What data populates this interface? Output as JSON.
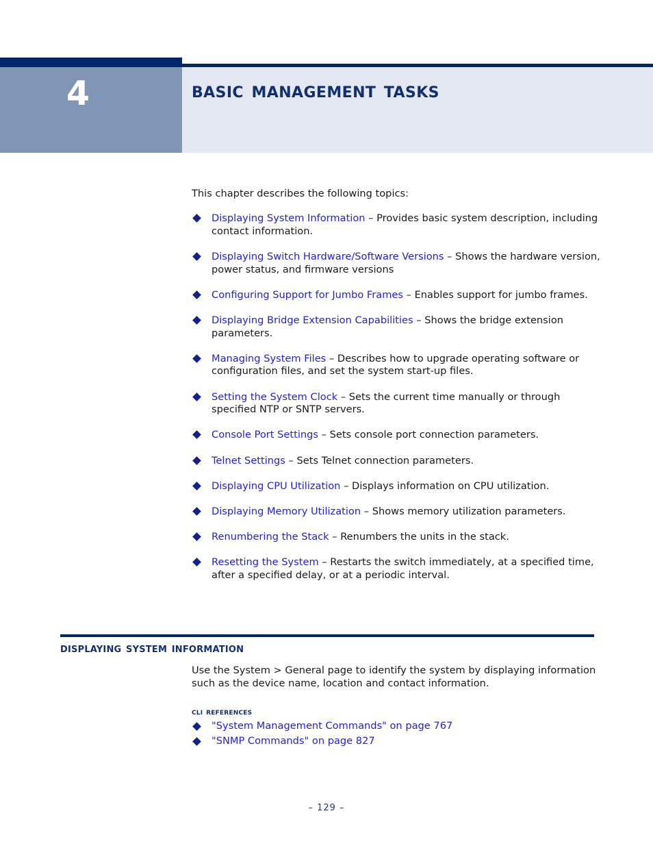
{
  "chapter": {
    "number": "4",
    "title": "Basic Management Tasks"
  },
  "intro": "This chapter describes the following topics:",
  "topics": [
    {
      "link": "Displaying System Information",
      "desc": " – Provides basic system description, including contact information."
    },
    {
      "link": "Displaying Switch Hardware/Software Versions",
      "desc": " – Shows the hardware version, power status, and firmware versions"
    },
    {
      "link": "Configuring Support for Jumbo Frames",
      "desc": " – Enables support for jumbo frames."
    },
    {
      "link": "Displaying Bridge Extension Capabilities",
      "desc": " – Shows the bridge extension parameters."
    },
    {
      "link": "Managing System Files",
      "desc": " – Describes how to upgrade operating software or configuration files, and set the system start-up files."
    },
    {
      "link": "Setting the System Clock",
      "desc": " – Sets the current time manually or through specified NTP or SNTP servers."
    },
    {
      "link": "Console Port Settings",
      "desc": " – Sets console port connection parameters."
    },
    {
      "link": "Telnet Settings",
      "desc": " – Sets Telnet connection parameters."
    },
    {
      "link": "Displaying CPU Utilization",
      "desc": " – Displays information on CPU utilization."
    },
    {
      "link": "Displaying Memory Utilization",
      "desc": " – Shows memory utilization parameters."
    },
    {
      "link": "Renumbering the Stack",
      "desc": " – Renumbers the units in the stack."
    },
    {
      "link": "Resetting the System",
      "desc": " – Restarts the switch immediately, at a specified time, after a specified delay, or at a periodic interval."
    }
  ],
  "section": {
    "heading": "Displaying System Information",
    "body": "Use the System > General page to identify the system by displaying information such as the device name, location and contact information.",
    "cli_title": "CLI References",
    "cli_items": [
      "\"System Management Commands\" on page 767",
      "\"SNMP Commands\" on page 827"
    ]
  },
  "footer": {
    "page_label": "–  129  –"
  },
  "colors": {
    "navy": "#002868",
    "heading_navy": "#12306e",
    "sidebar_blue": "#8195b4",
    "panel_bg": "#e4e8f2",
    "link_blue": "#2222d6",
    "bullet_blue": "#12228c"
  }
}
